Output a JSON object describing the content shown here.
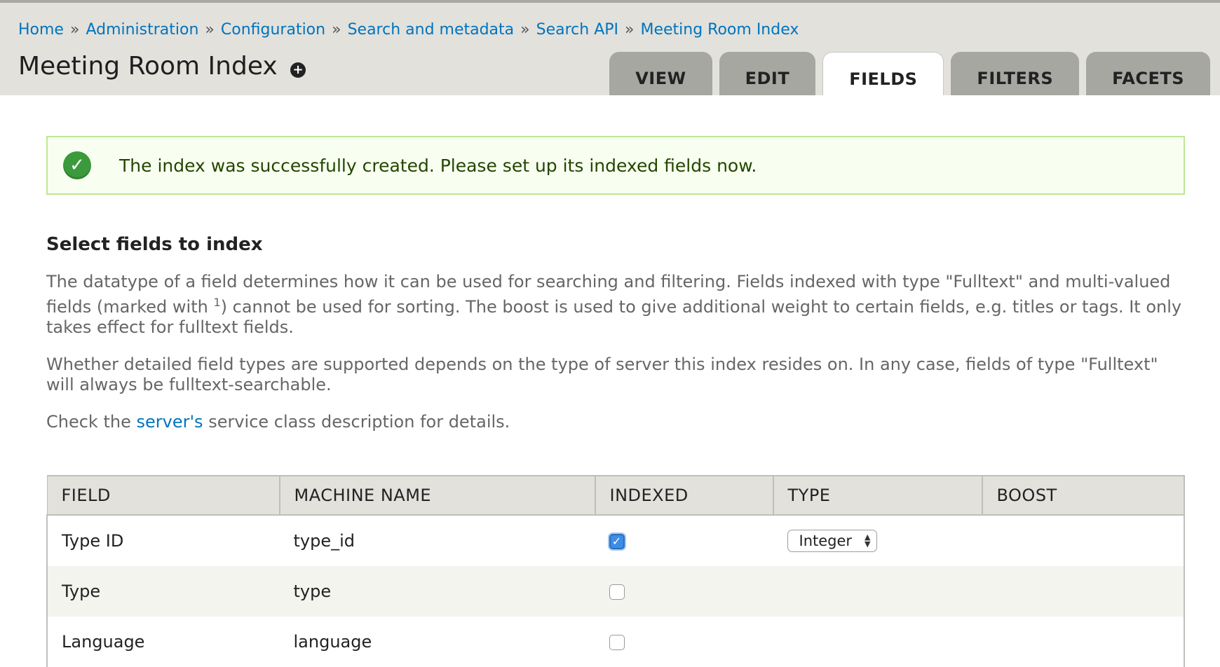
{
  "breadcrumb": {
    "items": [
      "Home",
      "Administration",
      "Configuration",
      "Search and metadata",
      "Search API",
      "Meeting Room Index"
    ],
    "separator": "»"
  },
  "page": {
    "title": "Meeting Room Index",
    "shortcut_symbol": "+"
  },
  "tabs": [
    {
      "label": "VIEW",
      "active": false
    },
    {
      "label": "EDIT",
      "active": false
    },
    {
      "label": "FIELDS",
      "active": true
    },
    {
      "label": "FILTERS",
      "active": false
    },
    {
      "label": "FACETS",
      "active": false
    }
  ],
  "status": {
    "message": "The index was successfully created. Please set up its indexed fields now."
  },
  "section": {
    "title": "Select fields to index",
    "para1_part1": "The datatype of a field determines how it can be used for searching and filtering. Fields indexed with type \"Fulltext\" and multi-valued fields (marked with ",
    "para1_sup": "1",
    "para1_part2": ") cannot be used for sorting. The boost is used to give additional weight to certain fields, e.g. titles or tags. It only takes effect for fulltext fields.",
    "para2": "Whether detailed field types are supported depends on the type of server this index resides on. In any case, fields of type \"Fulltext\" will always be fulltext-searchable.",
    "para3_before": "Check the ",
    "para3_link": "server's",
    "para3_after": " service class description for details."
  },
  "table": {
    "headers": [
      "FIELD",
      "MACHINE NAME",
      "INDEXED",
      "TYPE",
      "BOOST"
    ],
    "rows": [
      {
        "field": "Type ID",
        "machine_name": "type_id",
        "indexed": true,
        "type": "Integer"
      },
      {
        "field": "Type",
        "machine_name": "type",
        "indexed": false,
        "type": ""
      },
      {
        "field": "Language",
        "machine_name": "language",
        "indexed": false,
        "type": ""
      }
    ]
  },
  "colors": {
    "link": "#0074bd",
    "header_bg": "#e2e1dc",
    "tab_bg": "#a7a7a2",
    "status_border": "#bee695",
    "status_text": "#234600"
  },
  "icons": {
    "status": "check-circle-icon",
    "shortcut": "plus-circle-icon",
    "select": "select-arrows-icon"
  }
}
